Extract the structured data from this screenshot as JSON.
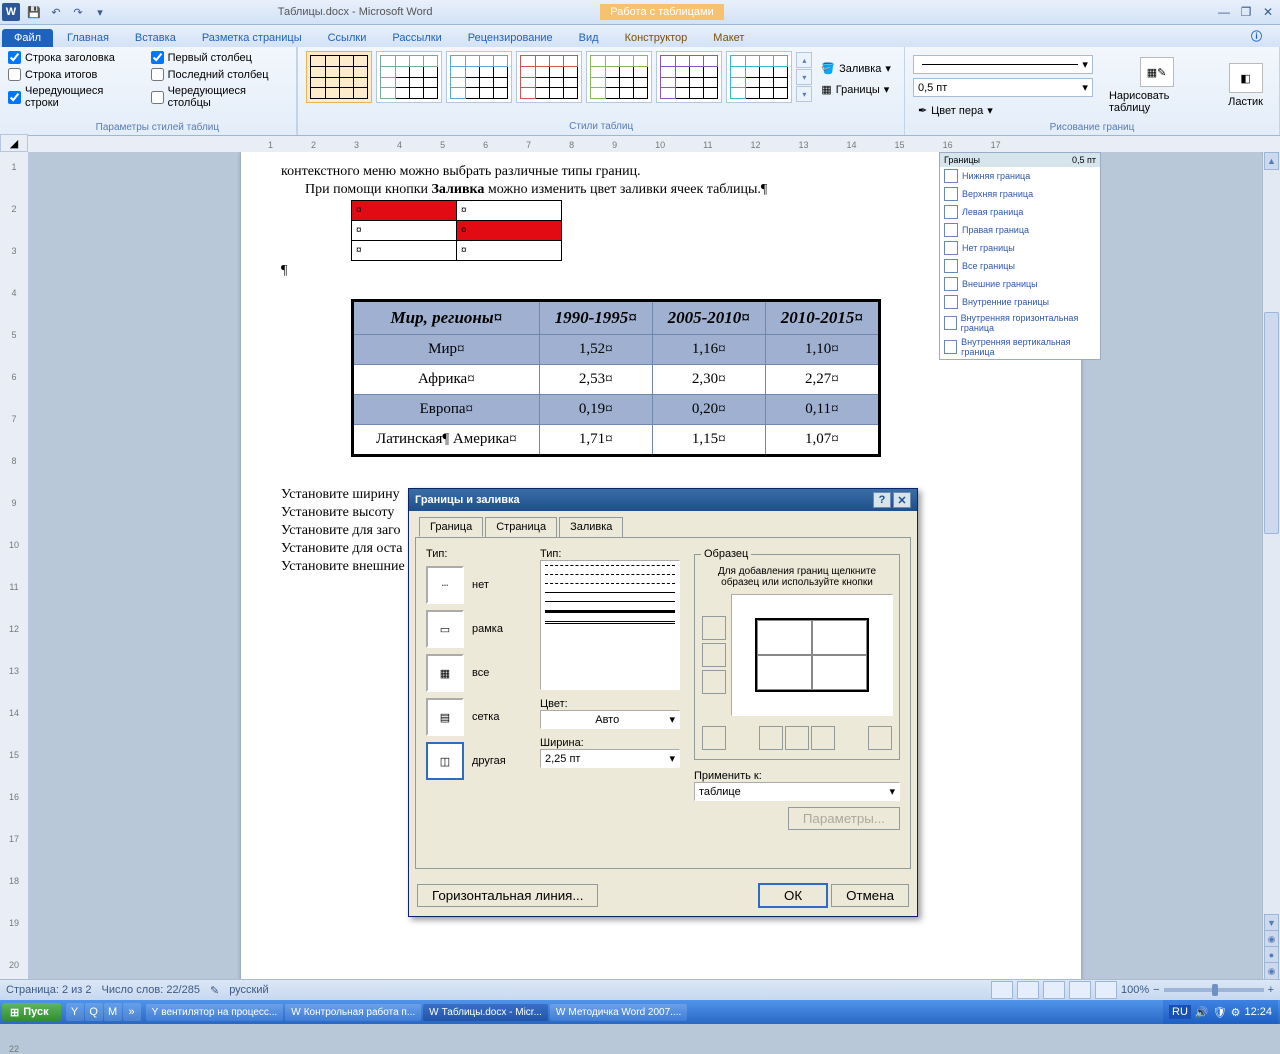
{
  "titlebar": {
    "doc_title": "Таблицы.docx - Microsoft Word",
    "table_tools": "Работа с таблицами"
  },
  "ribbon_tabs": {
    "file": "Файл",
    "home": "Главная",
    "insert": "Вставка",
    "layout": "Разметка страницы",
    "refs": "Ссылки",
    "mail": "Рассылки",
    "review": "Рецензирование",
    "view": "Вид",
    "design": "Конструктор",
    "tlayout": "Макет"
  },
  "ribbon": {
    "style_opts": {
      "header_row": "Строка заголовка",
      "total_row": "Строка итогов",
      "banded_rows": "Чередующиеся строки",
      "first_col": "Первый столбец",
      "last_col": "Последний столбец",
      "banded_cols": "Чередующиеся столбцы",
      "group_label": "Параметры стилей таблиц"
    },
    "styles_group": "Стили таблиц",
    "fill": "Заливка",
    "borders": "Границы",
    "pen_width": "0,5 пт",
    "pen_color": "Цвет пера",
    "draw_table": "Нарисовать таблицу",
    "eraser": "Ластик",
    "draw_group": "Рисование границ"
  },
  "doc": {
    "p0": "контекстного меню можно выбрать различные типы границ.",
    "p1a": "При помощи кнопки ",
    "p1b": "Заливка",
    "p1c": " можно изменить цвет заливки ячеек таблицы.¶",
    "after": [
      "Установите ширину",
      "Установите высоту",
      "Установите для заго",
      "Установите для оста",
      "Установите внешние"
    ],
    "table_headers": [
      "Мир, регионы¤",
      "1990-1995¤",
      "2005-2010¤",
      "2010-2015¤"
    ],
    "table_rows": [
      [
        "Мир¤",
        "1,52¤",
        "1,16¤",
        "1,10¤"
      ],
      [
        "Африка¤",
        "2,53¤",
        "2,30¤",
        "2,27¤"
      ],
      [
        "Европа¤",
        "0,19¤",
        "0,20¤",
        "0,11¤"
      ],
      [
        "Латинская¶ Америка¤",
        "1,71¤",
        "1,15¤",
        "1,07¤"
      ]
    ]
  },
  "borders_menu": {
    "hdr_l": "Границы",
    "hdr_r": "0,5 пт",
    "items": [
      "Нижняя граница",
      "Верхняя граница",
      "Левая граница",
      "Правая граница",
      "Нет границы",
      "Все границы",
      "Внешние границы",
      "Внутренние границы",
      "Внутренняя горизонтальная граница",
      "Внутренняя вертикальная граница"
    ]
  },
  "dialog": {
    "title": "Границы и заливка",
    "tabs": {
      "border": "Граница",
      "page": "Страница",
      "fill": "Заливка"
    },
    "type_label": "Тип:",
    "types": {
      "none": "нет",
      "box": "рамка",
      "all": "все",
      "grid": "сетка",
      "custom": "другая"
    },
    "line_type": "Тип:",
    "color": "Цвет:",
    "color_val": "Авто",
    "width": "Ширина:",
    "width_val": "2,25 пт",
    "sample": "Образец",
    "sample_hint": "Для добавления границ щелкните образец или используйте кнопки",
    "apply": "Применить к:",
    "apply_val": "таблице",
    "params": "Параметры...",
    "hline": "Горизонтальная линия...",
    "ok": "ОК",
    "cancel": "Отмена"
  },
  "status": {
    "page": "Страница: 2 из 2",
    "words": "Число слов: 22/285",
    "lang": "русский",
    "zoom": "100%"
  },
  "taskbar": {
    "start": "Пуск",
    "tasks": [
      "вентилятор на процесс...",
      "Контрольная работа п...",
      "Таблицы.docx - Micr...",
      "Методичка Word 2007...."
    ],
    "time": "12:24"
  }
}
